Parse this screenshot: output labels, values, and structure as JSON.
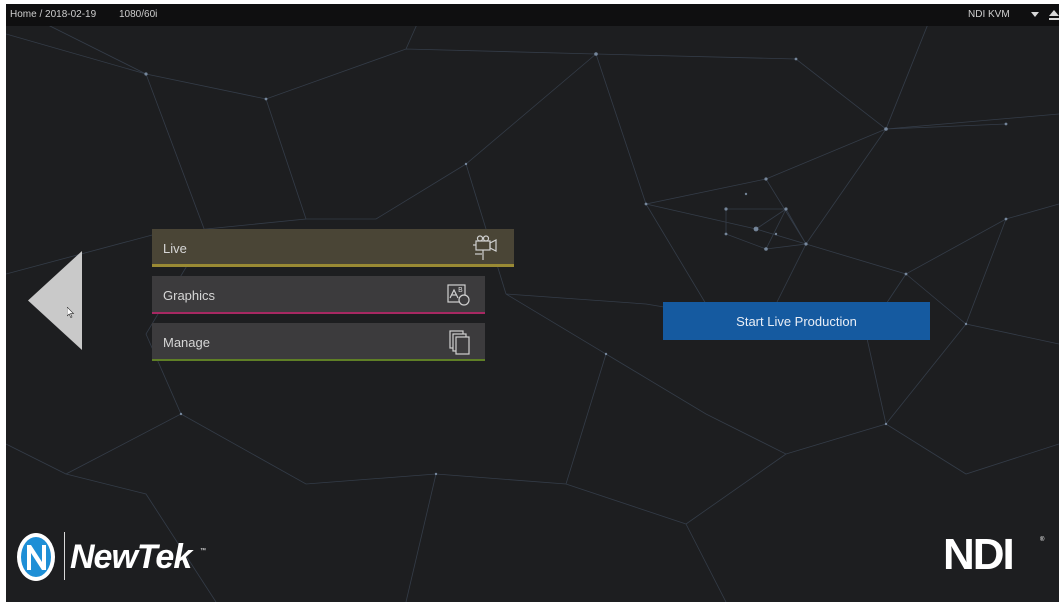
{
  "topbar": {
    "breadcrumb": "Home / 2018-02-19",
    "resolution": "1080/60i",
    "kvm_label": "NDI KVM"
  },
  "menu": {
    "items": [
      {
        "label": "Live",
        "icon": "video-camera-icon",
        "accent": "#9a8a34"
      },
      {
        "label": "Graphics",
        "icon": "graphics-layers-icon",
        "accent": "#a72862"
      },
      {
        "label": "Manage",
        "icon": "document-stack-icon",
        "accent": "#5f7f26"
      }
    ]
  },
  "start_button": {
    "label": "Start Live Production",
    "color": "#155aa0"
  },
  "logos": {
    "newtek": "NewTek",
    "ndi": "NDI"
  },
  "colors": {
    "background": "#1d1e20",
    "topbar": "#0f0f10"
  }
}
